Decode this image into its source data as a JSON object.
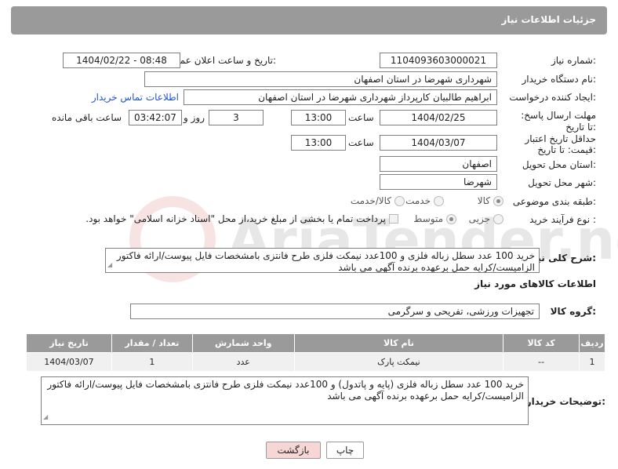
{
  "header": {
    "title": "جزئیات اطلاعات نیاز"
  },
  "fields": {
    "need_number": {
      "label": "شماره نیاز:",
      "value": "1104093603000021"
    },
    "announce": {
      "label": "تاریخ و ساعت اعلان عمومی:",
      "value": "1404/02/22 - 08:48"
    },
    "buyer_org": {
      "label": "نام دستگاه خریدار:",
      "value": "شهرداری شهرضا در استان اصفهان"
    },
    "creator": {
      "label": "ایجاد کننده درخواست:",
      "value": "ابراهیم طالبیان کارپرداز شهرداری شهرضا در استان اصفهان",
      "contact_link": "اطلاعات تماس خریدار"
    },
    "deadline": {
      "label": "مهلت ارسال پاسخ: تا تاریخ:",
      "date": "1404/02/25",
      "time_label": "ساعت",
      "time": "13:00",
      "days": "3",
      "days_label": "روز و",
      "remaining": "03:42:07",
      "remaining_label": "ساعت باقی مانده"
    },
    "validity": {
      "label": "حداقل تاریخ اعتبار قیمت: تا تاریخ:",
      "date": "1404/03/07",
      "time_label": "ساعت",
      "time": "13:00"
    },
    "province": {
      "label": "استان محل تحویل:",
      "value": "اصفهان"
    },
    "city": {
      "label": "شهر محل تحویل:",
      "value": "شهرضا"
    },
    "category": {
      "label": "طبقه بندی موضوعی:",
      "options": [
        "کالا",
        "خدمت",
        "کالا/خدمت"
      ]
    },
    "process": {
      "label": "نوع فرآیند خرید :",
      "options": [
        "جزیی",
        "متوسط"
      ],
      "note": "پرداخت تمام یا بخشی از مبلغ خرید،از محل \"اسناد خزانه اسلامی\" خواهد بود."
    }
  },
  "description": {
    "label": "شرح کلی نیاز:",
    "value": "خرید 100 عدد سطل زباله فلزی و 100عدد نیمکت فلزی طرح فانتزی بامشخصات فایل پیوست/ارائه فاکتور الزامیست/کرایه حمل برعهده برنده آگهی می باشد"
  },
  "goods_section": {
    "title": "اطلاعات کالاهای مورد نیاز"
  },
  "goods_group": {
    "label": "گروه کالا:",
    "value": "تجهیزات ورزشی، تفریحی و سرگرمی"
  },
  "table": {
    "headers": [
      "ردیف",
      "کد کالا",
      "نام کالا",
      "واحد شمارش",
      "تعداد / مقدار",
      "تاریخ نیاز"
    ],
    "rows": [
      [
        "1",
        "--",
        "نیمکت پارک",
        "عدد",
        "1",
        "1404/03/07"
      ]
    ]
  },
  "buyer_notes": {
    "label": "توضیحات خریدار:",
    "value": "خرید 100 عدد سطل زباله فلزی (پایه و پاتدول) و 100عدد نیمکت فلزی طرح فانتزی بامشخصات فایل پیوست/ارائه فاکتور الزامیست/کرایه حمل برعهده برنده آگهی می باشد"
  },
  "buttons": {
    "print": "چاپ",
    "back": "بازگشت"
  },
  "watermark_text": "AriaTender.neT",
  "colors": {
    "header_bg": "#9a9a9a",
    "link": "#2255cc",
    "back_btn_bg": "#f7d6d6"
  }
}
